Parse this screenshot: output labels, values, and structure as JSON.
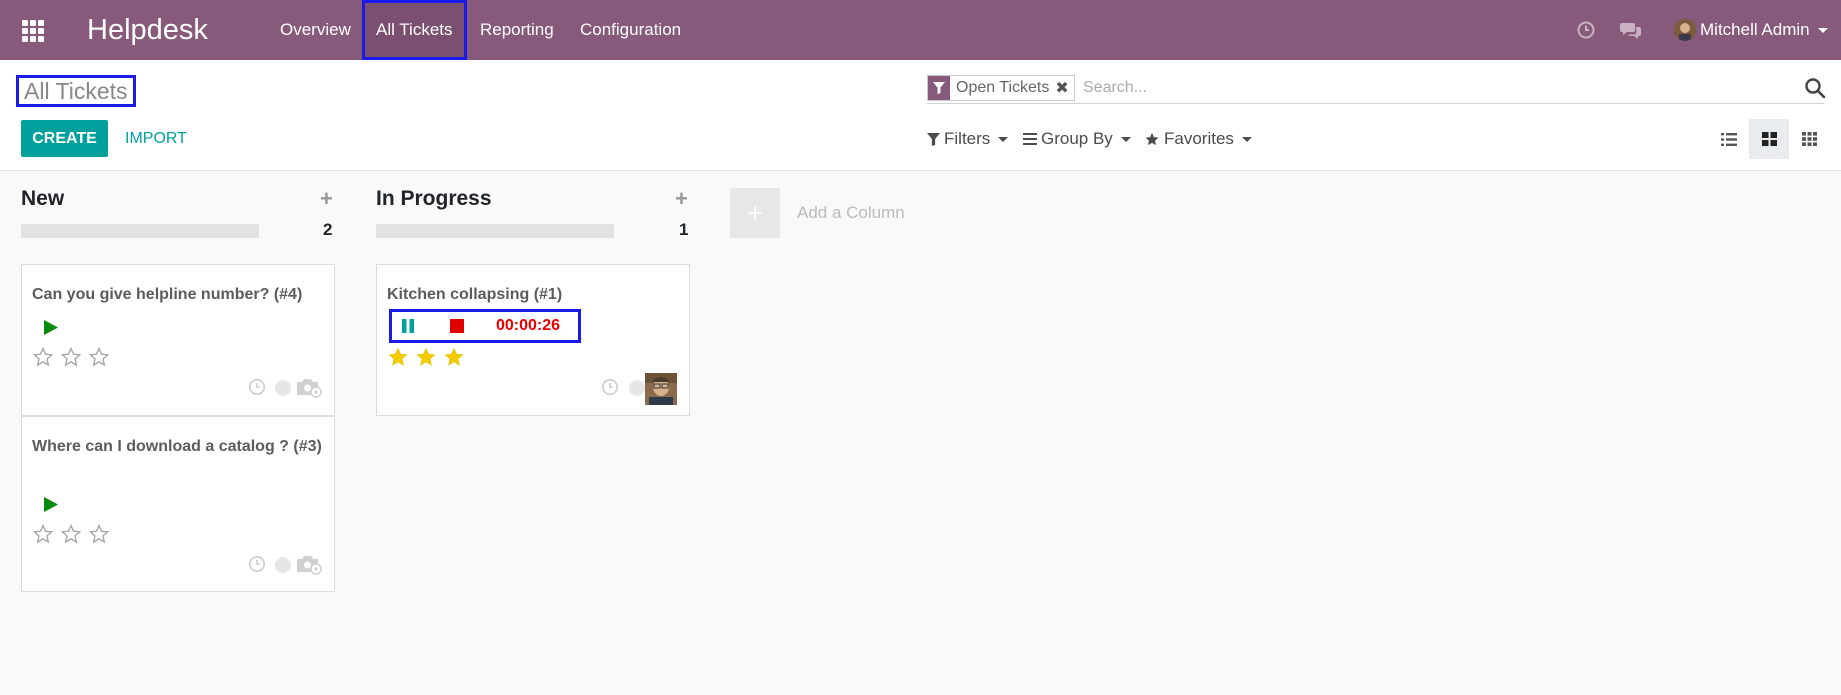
{
  "navbar": {
    "brand": "Helpdesk",
    "menu": [
      {
        "label": "Overview"
      },
      {
        "label": "All Tickets"
      },
      {
        "label": "Reporting"
      },
      {
        "label": "Configuration"
      }
    ],
    "active_menu": "All Tickets",
    "user_name": "Mitchell Admin",
    "background_color": "#875a7b"
  },
  "control_panel": {
    "page_title": "All Tickets",
    "create_label": "CREATE",
    "import_label": "IMPORT",
    "search": {
      "facet_label": "Open Tickets",
      "placeholder": "Search..."
    },
    "filters_label": "Filters",
    "group_by_label": "Group By",
    "favorites_label": "Favorites",
    "active_view": "kanban"
  },
  "kanban": {
    "columns": [
      {
        "title": "New",
        "count": "2",
        "cards": [
          {
            "title": "Can you give helpline number? (#4)",
            "stars": 0
          },
          {
            "title": "Where can I download a catalog ? (#3)",
            "stars": 0
          }
        ]
      },
      {
        "title": "In Progress",
        "count": "1",
        "cards": [
          {
            "title": "Kitchen collapsing (#1)",
            "stars": 3,
            "timer": "00:00:26"
          }
        ]
      }
    ],
    "add_column_label": "Add a Column"
  },
  "colors": {
    "accent": "#00a09d",
    "star_filled": "#f3cc00",
    "timer_red": "#e00000",
    "play_green": "#0a8a0a"
  }
}
